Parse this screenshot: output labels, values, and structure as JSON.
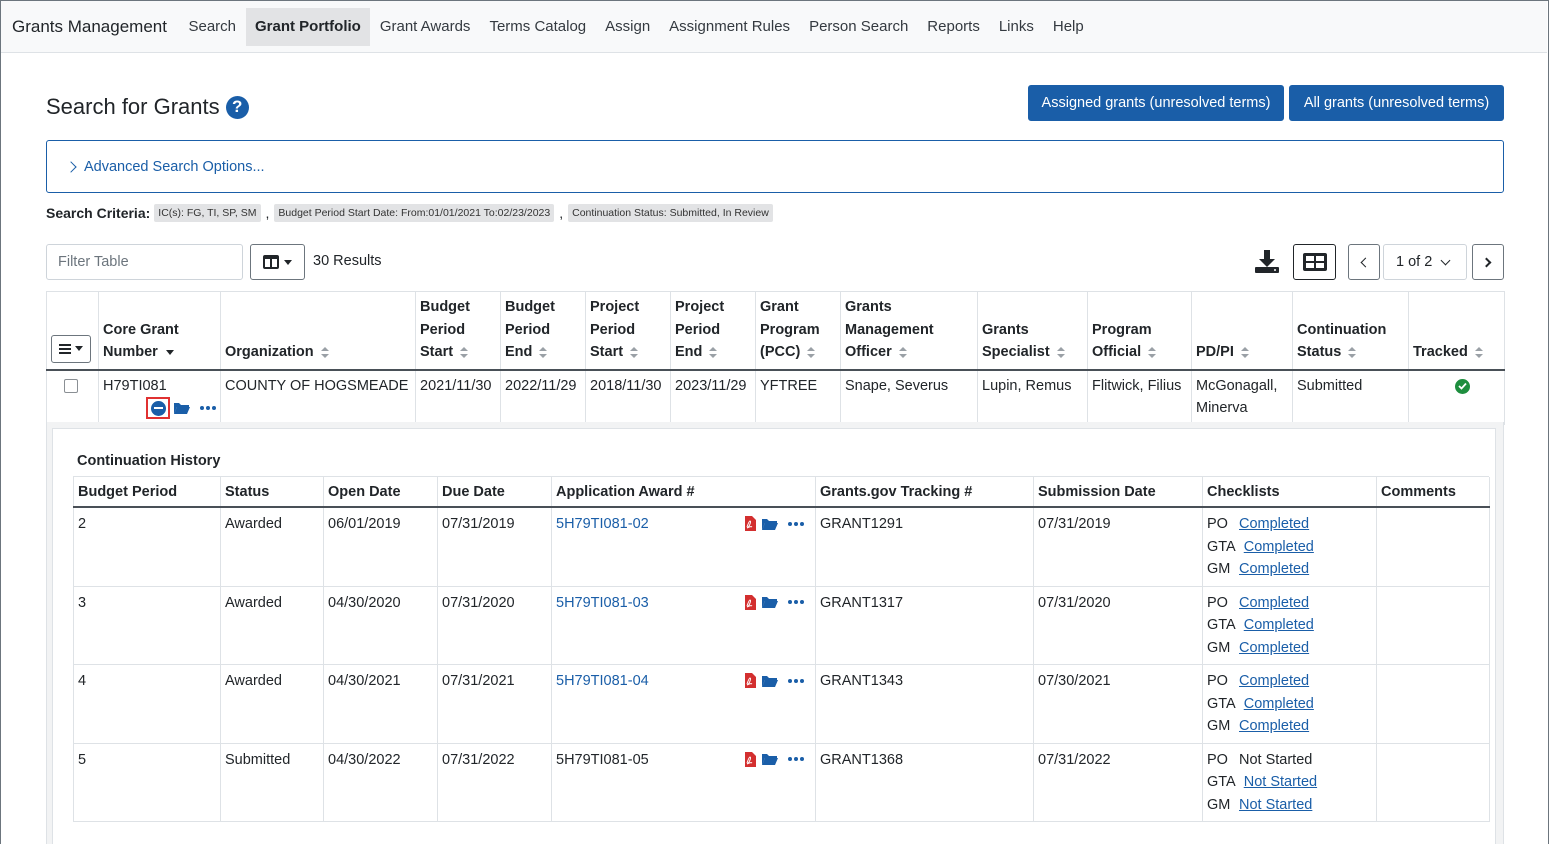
{
  "nav": {
    "brand": "Grants Management",
    "items": [
      "Search",
      "Grant Portfolio",
      "Grant Awards",
      "Terms Catalog",
      "Assign",
      "Assignment Rules",
      "Person Search",
      "Reports",
      "Links",
      "Help"
    ],
    "active": "Grant Portfolio"
  },
  "page": {
    "title": "Search for Grants",
    "help_icon": "?",
    "btn_assigned": "Assigned grants (unresolved terms)",
    "btn_all": "All grants (unresolved terms)",
    "advanced": "Advanced Search Options..."
  },
  "criteria": {
    "label": "Search Criteria:",
    "chips": [
      "IC(s): FG, TI, SP, SM",
      "Budget Period Start Date: From:01/01/2021 To:02/23/2023",
      "Continuation Status: Submitted, In Review"
    ],
    "separator": ","
  },
  "toolbar": {
    "filter_placeholder": "Filter Table",
    "results": "30 Results",
    "page_select": "1 of 2"
  },
  "table": {
    "headers": {
      "core_grant": [
        "Core Grant",
        "Number"
      ],
      "organization": "Organization",
      "bp_start": [
        "Budget",
        "Period",
        "Start"
      ],
      "bp_end": [
        "Budget",
        "Period",
        "End"
      ],
      "pp_start": [
        "Project",
        "Period",
        "Start"
      ],
      "pp_end": [
        "Project",
        "Period",
        "End"
      ],
      "program": [
        "Grant",
        "Program",
        "(PCC)"
      ],
      "gmo": [
        "Grants",
        "Management",
        "Officer"
      ],
      "specialist": [
        "Grants",
        "Specialist"
      ],
      "po": [
        "Program",
        "Official"
      ],
      "pdpi": "PD/PI",
      "cont": [
        "Continuation",
        "Status"
      ],
      "tracked": "Tracked"
    },
    "row": {
      "grant": "H79TI081",
      "organization": "COUNTY OF HOGSMEADE",
      "bp_start": "2021/11/30",
      "bp_end": "2022/11/29",
      "pp_start": "2018/11/30",
      "pp_end": "2023/11/29",
      "program": "YFTREE",
      "gmo": "Snape, Severus",
      "specialist": "Lupin, Remus",
      "po": "Flitwick, Filius",
      "pdpi": "McGonagall, Minerva",
      "cont_status": "Submitted"
    }
  },
  "history": {
    "title": "Continuation History",
    "headers": [
      "Budget Period",
      "Status",
      "Open Date",
      "Due Date",
      "Application Award #",
      "Grants.gov Tracking #",
      "Submission Date",
      "Checklists",
      "Comments"
    ],
    "rows": [
      {
        "bp": "2",
        "status": "Awarded",
        "open": "06/01/2019",
        "due": "07/31/2019",
        "award": "5H79TI081-02",
        "tracking": "GRANT1291",
        "submitted": "07/31/2019",
        "checklists": [
          {
            "role": "PO",
            "state": "Completed"
          },
          {
            "role": "GTA",
            "state": "Completed"
          },
          {
            "role": "GM",
            "state": "Completed"
          }
        ]
      },
      {
        "bp": "3",
        "status": "Awarded",
        "open": "04/30/2020",
        "due": "07/31/2020",
        "award": "5H79TI081-03",
        "tracking": "GRANT1317",
        "submitted": "07/31/2020",
        "checklists": [
          {
            "role": "PO",
            "state": "Completed"
          },
          {
            "role": "GTA",
            "state": "Completed"
          },
          {
            "role": "GM",
            "state": "Completed"
          }
        ]
      },
      {
        "bp": "4",
        "status": "Awarded",
        "open": "04/30/2021",
        "due": "07/31/2021",
        "award": "5H79TI081-04",
        "tracking": "GRANT1343",
        "submitted": "07/30/2021",
        "checklists": [
          {
            "role": "PO",
            "state": "Completed"
          },
          {
            "role": "GTA",
            "state": "Completed"
          },
          {
            "role": "GM",
            "state": "Completed"
          }
        ]
      },
      {
        "bp": "5",
        "status": "Submitted",
        "open": "04/30/2022",
        "due": "07/31/2022",
        "award": "5H79TI081-05",
        "tracking": "GRANT1368",
        "submitted": "07/31/2022",
        "checklists": [
          {
            "role": "PO",
            "state": "Not Started"
          },
          {
            "role": "GTA",
            "state": "Not Started"
          },
          {
            "role": "GM",
            "state": "Not Started"
          }
        ]
      }
    ]
  },
  "colors": {
    "primary": "#1a5ea8",
    "success": "#1e8e3e",
    "pdf": "#d32f2f",
    "highlight": "#e03131"
  },
  "icons": [
    "help-icon",
    "chevron-right-icon",
    "columns-icon",
    "download-icon",
    "grid-view-icon",
    "chevron-left-icon",
    "chevron-down-icon",
    "menu-icon",
    "collapse-minus-icon",
    "folder-icon",
    "more-icon",
    "check-circle-icon",
    "pdf-icon"
  ]
}
